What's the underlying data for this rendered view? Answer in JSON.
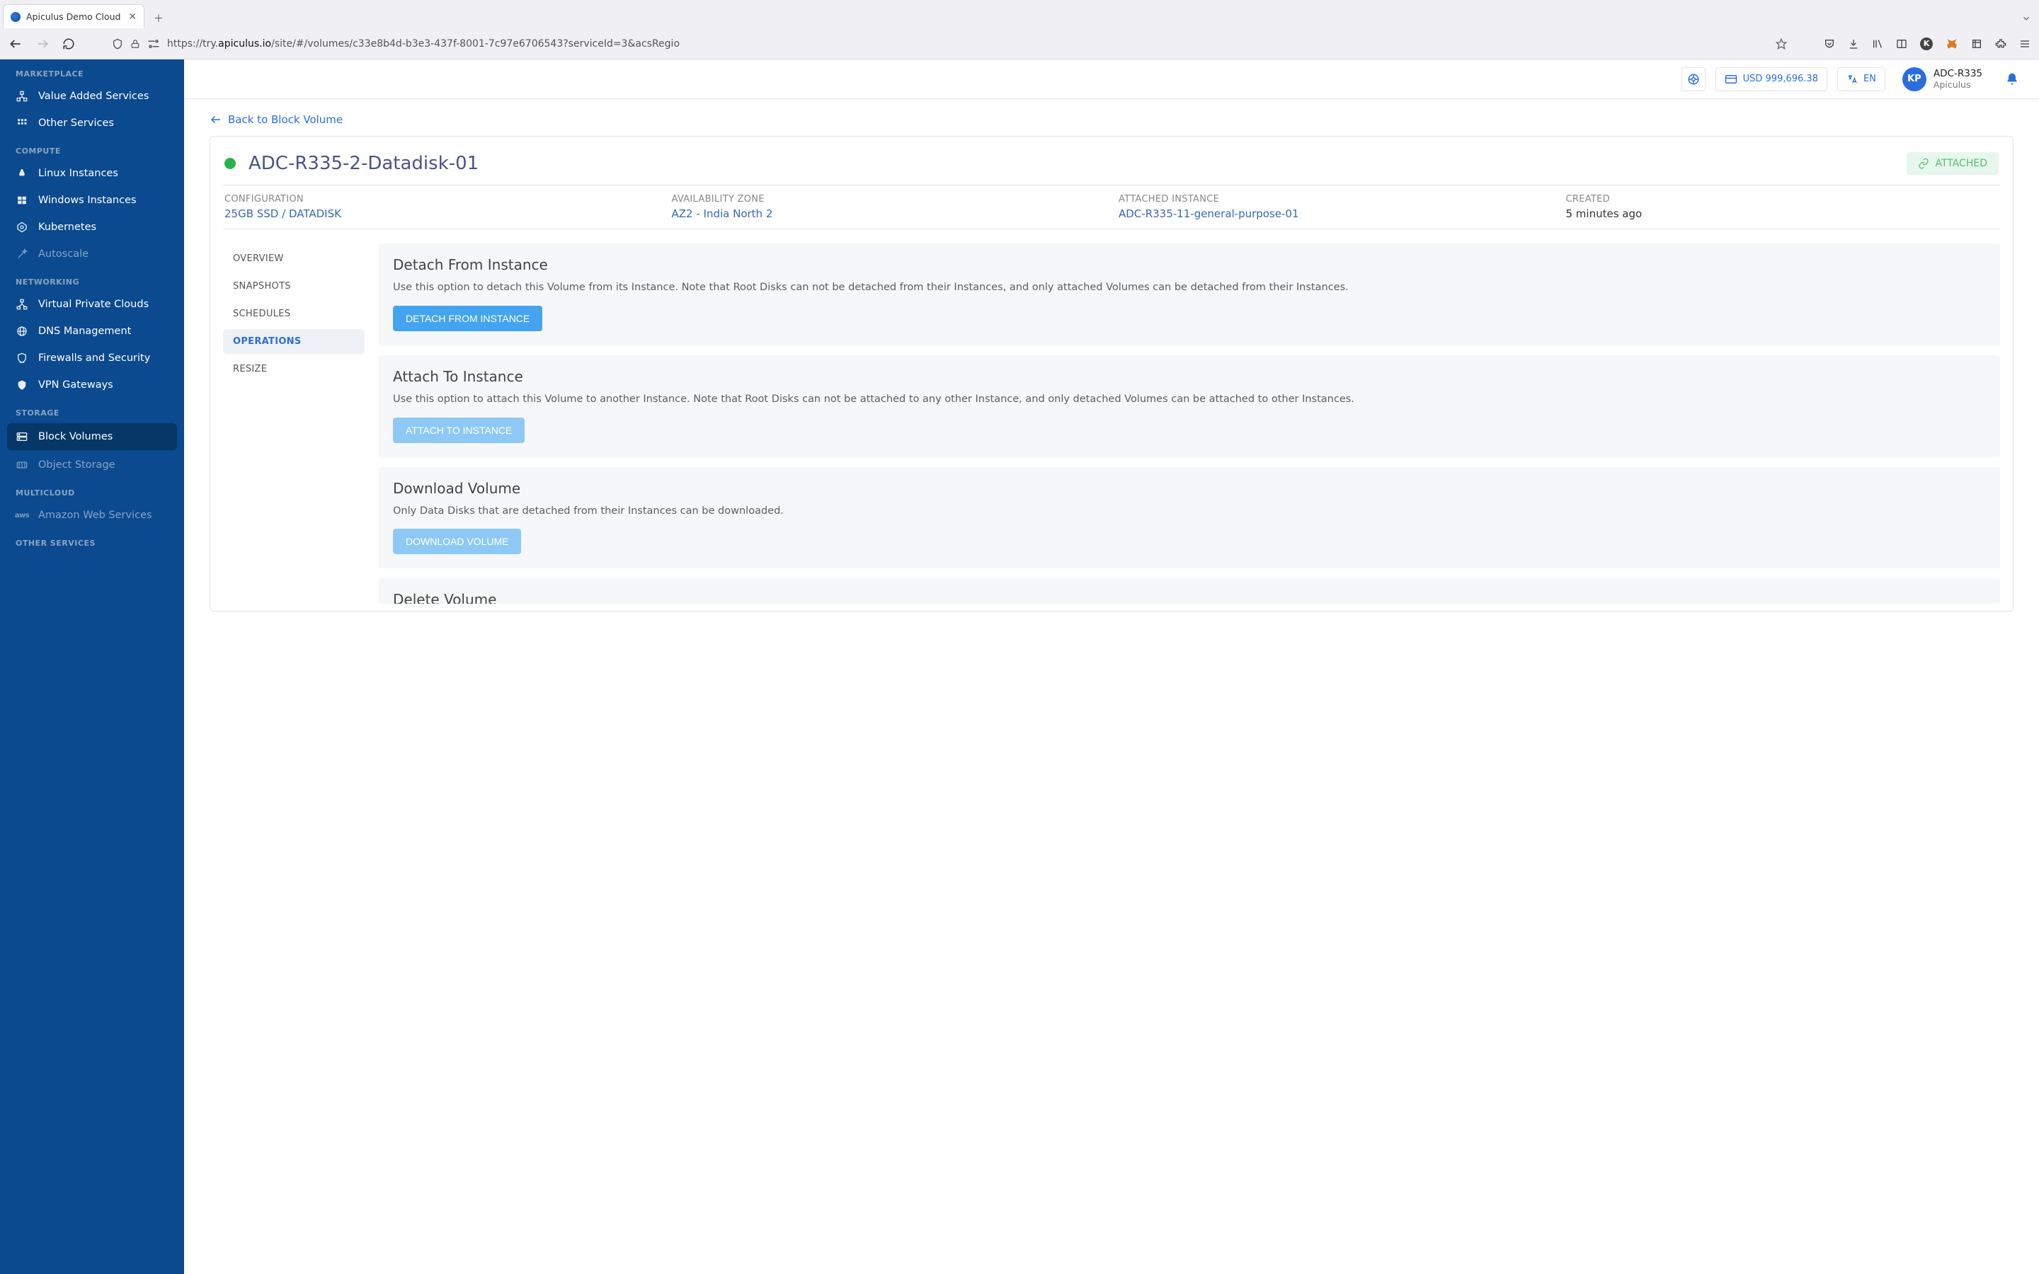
{
  "browser": {
    "tab_title": "Apiculus Demo Cloud",
    "url_prefix": "https://try.",
    "url_domain": "apiculus.io",
    "url_path": "/site/#/volumes/c33e8b4d-b3e3-437f-8001-7c97e6706543?serviceId=3&acsRegio"
  },
  "topbar": {
    "balance": "USD 999,696.38",
    "lang": "EN",
    "avatar": "KP",
    "user_name": "ADC-R335",
    "user_org": "Apiculus"
  },
  "sidebar": {
    "sections": [
      {
        "heading": "MARKETPLACE",
        "items": [
          {
            "icon": "gizmo",
            "label": "Value Added Services"
          },
          {
            "icon": "grid",
            "label": "Other Services"
          }
        ]
      },
      {
        "heading": "COMPUTE",
        "items": [
          {
            "icon": "linux",
            "label": "Linux Instances"
          },
          {
            "icon": "windows",
            "label": "Windows Instances"
          },
          {
            "icon": "kube",
            "label": "Kubernetes"
          },
          {
            "icon": "wand",
            "label": "Autoscale",
            "muted": true
          }
        ]
      },
      {
        "heading": "NETWORKING",
        "items": [
          {
            "icon": "net",
            "label": "Virtual Private Clouds"
          },
          {
            "icon": "globe",
            "label": "DNS Management"
          },
          {
            "icon": "shield",
            "label": "Firewalls and Security"
          },
          {
            "icon": "vpn",
            "label": "VPN Gateways"
          }
        ]
      },
      {
        "heading": "STORAGE",
        "items": [
          {
            "icon": "block",
            "label": "Block Volumes",
            "active": true
          },
          {
            "icon": "object",
            "label": "Object Storage",
            "muted": true
          }
        ]
      },
      {
        "heading": "MULTICLOUD",
        "items": [
          {
            "icon": "aws",
            "label": "Amazon Web Services",
            "muted": true
          }
        ]
      },
      {
        "heading": "OTHER SERVICES",
        "items": []
      }
    ]
  },
  "page": {
    "backlink": "Back to Block Volume",
    "volume_name": "ADC-R335-2-Datadisk-01",
    "state_label": "ATTACHED",
    "meta": {
      "config_label": "CONFIGURATION",
      "config_value": "25GB SSD / DATADISK",
      "az_label": "AVAILABILITY ZONE",
      "az_value": "AZ2 - India North 2",
      "inst_label": "ATTACHED INSTANCE",
      "inst_value": "ADC-R335-11-general-purpose-01",
      "created_label": "CREATED",
      "created_value": "5 minutes ago"
    },
    "subnav": [
      {
        "label": "OVERVIEW"
      },
      {
        "label": "SNAPSHOTS"
      },
      {
        "label": "SCHEDULES"
      },
      {
        "label": "OPERATIONS",
        "active": true
      },
      {
        "label": "RESIZE"
      }
    ],
    "ops": [
      {
        "title": "Detach From Instance",
        "desc": "Use this option to detach this Volume from its Instance. Note that Root Disks can not be detached from their Instances, and only attached Volumes can be detached from their Instances.",
        "button": "DETACH FROM INSTANCE",
        "enabled": true
      },
      {
        "title": "Attach To Instance",
        "desc": "Use this option to attach this Volume to another Instance. Note that Root Disks can not be attached to any other Instance, and only detached Volumes can be attached to other Instances.",
        "button": "ATTACH TO INSTANCE",
        "enabled": false
      },
      {
        "title": "Download Volume",
        "desc": "Only Data Disks that are detached from their Instances can be downloaded.",
        "button": "DOWNLOAD VOLUME",
        "enabled": false
      },
      {
        "title": "Delete Volume",
        "desc": "",
        "button": "",
        "enabled": false,
        "peek": true
      }
    ]
  }
}
